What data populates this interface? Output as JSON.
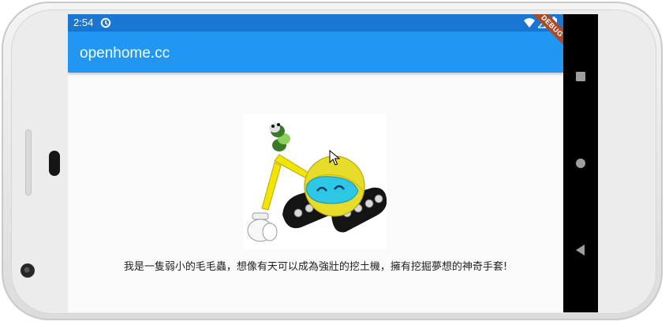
{
  "status_bar": {
    "time": "2:54",
    "icons": [
      "sync-icon",
      "wifi-icon",
      "signal-icon",
      "battery-icon"
    ],
    "color": "#1976d2"
  },
  "app_bar": {
    "title": "openhome.cc",
    "color": "#2196f3"
  },
  "debug_banner": {
    "label": "DEBUG"
  },
  "content": {
    "image_description": "caterpillar-excavator-illustration",
    "caption": "我是一隻弱小的毛毛蟲，想像有天可以成為強壯的挖土機，擁有挖掘夢想的神奇手套!"
  },
  "navigation_bar": {
    "buttons": [
      "recents-button",
      "home-button",
      "back-button"
    ]
  }
}
